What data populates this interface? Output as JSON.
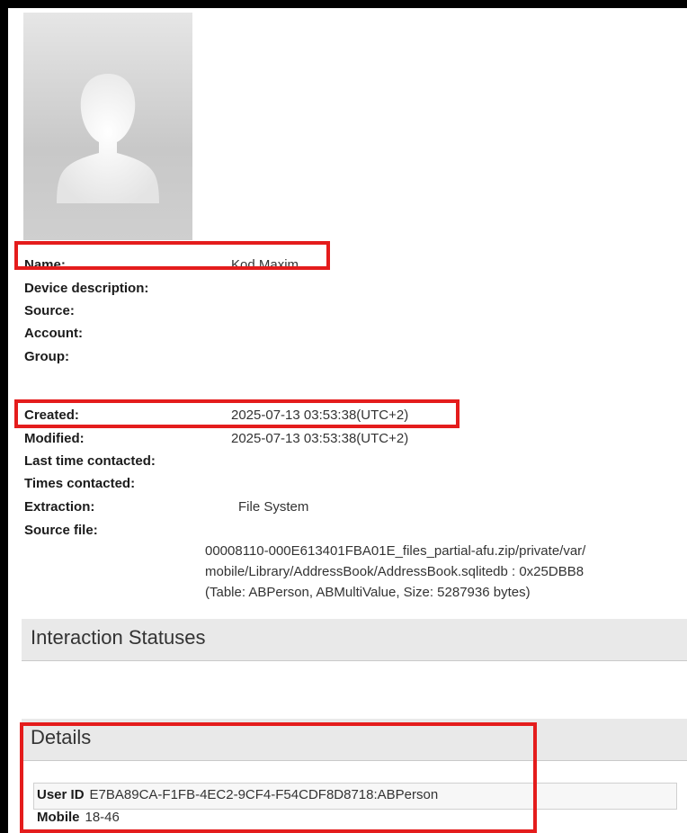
{
  "avatar": {
    "icon": "person-silhouette-icon"
  },
  "fields": [
    {
      "label": "Name:",
      "value": "Kod Maxim"
    },
    {
      "label": "Device description:",
      "value": ""
    },
    {
      "label": "Source:",
      "value": ""
    },
    {
      "label": "Account:",
      "value": ""
    },
    {
      "label": "Group:",
      "value": ""
    },
    {
      "label": "Created:",
      "value": "2025-07-13 03:53:38(UTC+2)"
    },
    {
      "label": "Modified:",
      "value": "2025-07-13 03:53:38(UTC+2)"
    },
    {
      "label": "Last time contacted:",
      "value": ""
    },
    {
      "label": "Times contacted:",
      "value": ""
    },
    {
      "label": "Extraction:",
      "value": "File System"
    },
    {
      "label": "Source file:",
      "value": ""
    }
  ],
  "source_file_lines": [
    "00008110-000E613401FBA01E_files_partial-afu.zip/private/var/",
    "mobile/Library/AddressBook/AddressBook.sqlitedb : 0x25DBB8",
    "(Table: ABPerson, ABMultiValue, Size: 5287936 bytes)"
  ],
  "sections": {
    "interaction_statuses": "Interaction Statuses",
    "details": "Details"
  },
  "details": [
    {
      "key": "User ID",
      "value": "E7BA89CA-F1FB-4EC2-9CF4-F54CDF8D8718:ABPerson"
    },
    {
      "key": "Mobile",
      "value": "18-46"
    }
  ],
  "colors": {
    "highlight": "#e41c1c",
    "section_bg": "#e9e9e9"
  }
}
